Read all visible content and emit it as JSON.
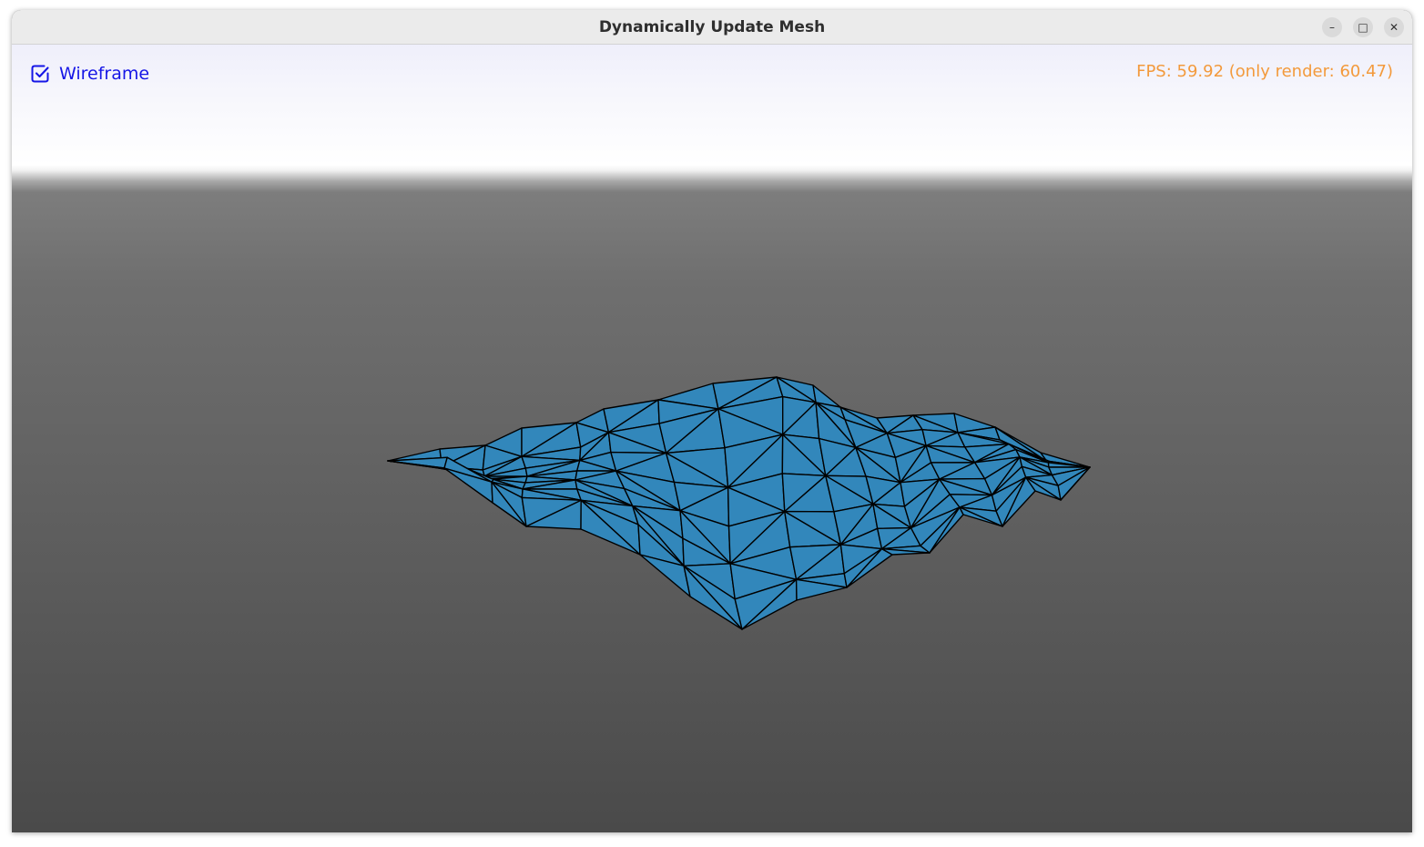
{
  "window": {
    "title": "Dynamically Update Mesh",
    "controls": {
      "minimize_icon": "minimize-icon",
      "maximize_icon": "maximize-icon",
      "close_icon": "close-icon"
    }
  },
  "overlay": {
    "wireframe": {
      "label": "Wireframe",
      "checked": true,
      "icon": "checkbox-checked-icon",
      "color": "#1616e6"
    },
    "fps_text": "FPS: 59.92 (only render: 60.47)",
    "fps_color": "#f39a3c"
  },
  "scene": {
    "mesh_fill_color": "#3287bb",
    "wire_color": "#000000",
    "wireframe_enabled": true
  }
}
